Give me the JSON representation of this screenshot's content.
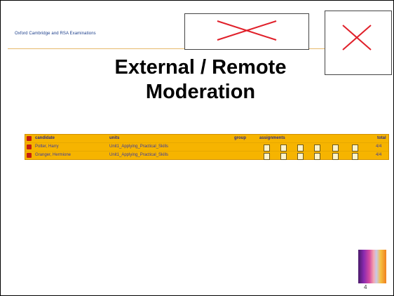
{
  "header": {
    "org_text": "Oxford Cambridge and RSA Examinations"
  },
  "title": {
    "line1": "External / Remote",
    "line2": "Moderation"
  },
  "table": {
    "headers": {
      "candidate": "candidate",
      "units": "units",
      "group": "group",
      "assignments": "assignments",
      "total": "total"
    },
    "rows": [
      {
        "candidate": "Potter, Harry",
        "unit": "Unit1_Applying_Practical_Skills",
        "total": "4/4"
      },
      {
        "candidate": "Granger, Hermione",
        "unit": "Unit1_Applying_Practical_Skills",
        "total": "4/4"
      }
    ]
  },
  "footer": {
    "page_number": "4"
  },
  "colors": {
    "grid_bg": "#f6b400",
    "title": "#000000",
    "header_text": "#1a3d8a"
  }
}
